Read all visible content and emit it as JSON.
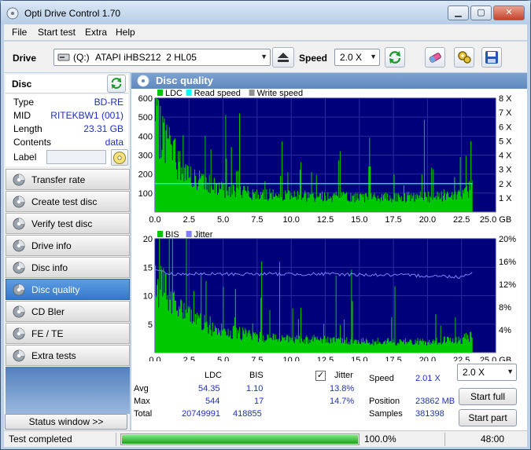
{
  "window": {
    "title": "Opti Drive Control 1.70"
  },
  "menu": [
    "File",
    "Start test",
    "Extra",
    "Help"
  ],
  "toolbar": {
    "drive_label": "Drive",
    "drive_letter": "(Q:)",
    "drive_name": "ATAPI iHBS212  2 HL05",
    "speed_label": "Speed",
    "speed_value": "2.0 X"
  },
  "disc": {
    "header": "Disc",
    "rows": [
      {
        "k": "Type",
        "v": "BD-RE"
      },
      {
        "k": "MID",
        "v": "RITEKBW1 (001)"
      },
      {
        "k": "Length",
        "v": "23.31 GB"
      },
      {
        "k": "Contents",
        "v": "data"
      }
    ],
    "label_key": "Label",
    "label_value": ""
  },
  "nav": [
    "Transfer rate",
    "Create test disc",
    "Verify test disc",
    "Drive info",
    "Disc info",
    "Disc quality",
    "CD Bler",
    "FE / TE",
    "Extra tests"
  ],
  "nav_active": "Disc quality",
  "status_window_btn": "Status window >>",
  "panel": {
    "title": "Disc quality"
  },
  "colors": {
    "ldc": "#00c800",
    "bis": "#00c800",
    "read": "#00ffff",
    "write": "#909090",
    "jitter": "#8080ff",
    "plot_bg": "#00007a"
  },
  "chart_data": [
    {
      "type": "area",
      "legend": [
        "LDC",
        "Read speed",
        "Write speed"
      ],
      "xlim": [
        0,
        25
      ],
      "xticks": [
        "0.0",
        "2.5",
        "5.0",
        "7.5",
        "10.0",
        "12.5",
        "15.0",
        "17.5",
        "20.0",
        "22.5",
        "25.0 GB"
      ],
      "ylim": [
        0,
        600
      ],
      "yticks_left": [
        "600",
        "500",
        "400",
        "300",
        "200",
        "100"
      ],
      "yticks_right": [
        "8 X",
        "7 X",
        "6 X",
        "5 X",
        "4 X",
        "3 X",
        "2 X",
        "1 X"
      ],
      "y2lim": [
        0,
        8
      ],
      "data_end_gb": 23.31,
      "ldc_profile": {
        "x": [
          0.0,
          0.5,
          1.0,
          1.5,
          2.0,
          2.5,
          3.0,
          4.0,
          5.0,
          6.0,
          7.5,
          10.0,
          12.5,
          15.0,
          17.5,
          20.0,
          22.5,
          23.31
        ],
        "y": [
          470,
          440,
          380,
          300,
          250,
          200,
          175,
          150,
          120,
          110,
          100,
          90,
          90,
          80,
          80,
          85,
          100,
          140
        ]
      },
      "read_speed": {
        "x": [
          0,
          23.31
        ],
        "y": [
          2.0,
          2.0
        ]
      }
    },
    {
      "type": "area",
      "legend": [
        "BIS",
        "Jitter"
      ],
      "xlim": [
        0,
        25
      ],
      "xticks": [
        "0.0",
        "2.5",
        "5.0",
        "7.5",
        "10.0",
        "12.5",
        "15.0",
        "17.5",
        "20.0",
        "22.5",
        "25.0 GB"
      ],
      "ylim": [
        0,
        20
      ],
      "yticks_left": [
        "20",
        "15",
        "10",
        "5"
      ],
      "yticks_right": [
        "20%",
        "16%",
        "12%",
        "8%",
        "4%"
      ],
      "y2lim": [
        0,
        20
      ],
      "data_end_gb": 23.31,
      "bis_profile": {
        "x": [
          0.0,
          0.5,
          1.0,
          1.5,
          2.0,
          3.0,
          4.0,
          5.0,
          7.5,
          10.0,
          12.5,
          15.0,
          17.5,
          20.0,
          22.5,
          23.31
        ],
        "y": [
          13,
          12,
          10,
          8,
          7,
          6,
          5,
          4,
          3,
          2.5,
          2.5,
          2,
          2,
          2,
          2.5,
          3
        ]
      },
      "jitter": {
        "x": [
          0,
          1.0,
          5.0,
          12.5,
          20.0,
          22.5,
          23.31
        ],
        "y": [
          14.7,
          13.8,
          13.8,
          13.8,
          13.5,
          13.3,
          14.2
        ]
      }
    }
  ],
  "stats": {
    "col_ldc": "LDC",
    "col_bis": "BIS",
    "col_jitter": "Jitter",
    "avg_label": "Avg",
    "max_label": "Max",
    "total_label": "Total",
    "avg_ldc": "54.35",
    "avg_bis": "1.10",
    "avg_jitter": "13.8%",
    "max_ldc": "544",
    "max_bis": "17",
    "max_jitter": "14.7%",
    "total_ldc": "20749991",
    "total_bis": "418855",
    "speed_label": "Speed",
    "speed_value": "2.01 X",
    "position_label": "Position",
    "position_value": "23862 MB",
    "samples_label": "Samples",
    "samples_value": "381398",
    "speed_select": "2.0 X",
    "start_full": "Start full",
    "start_part": "Start part",
    "jitter_checked": true
  },
  "statusbar": {
    "text": "Test completed",
    "progress": 1.0,
    "percent": "100.0%",
    "time": "48:00"
  }
}
